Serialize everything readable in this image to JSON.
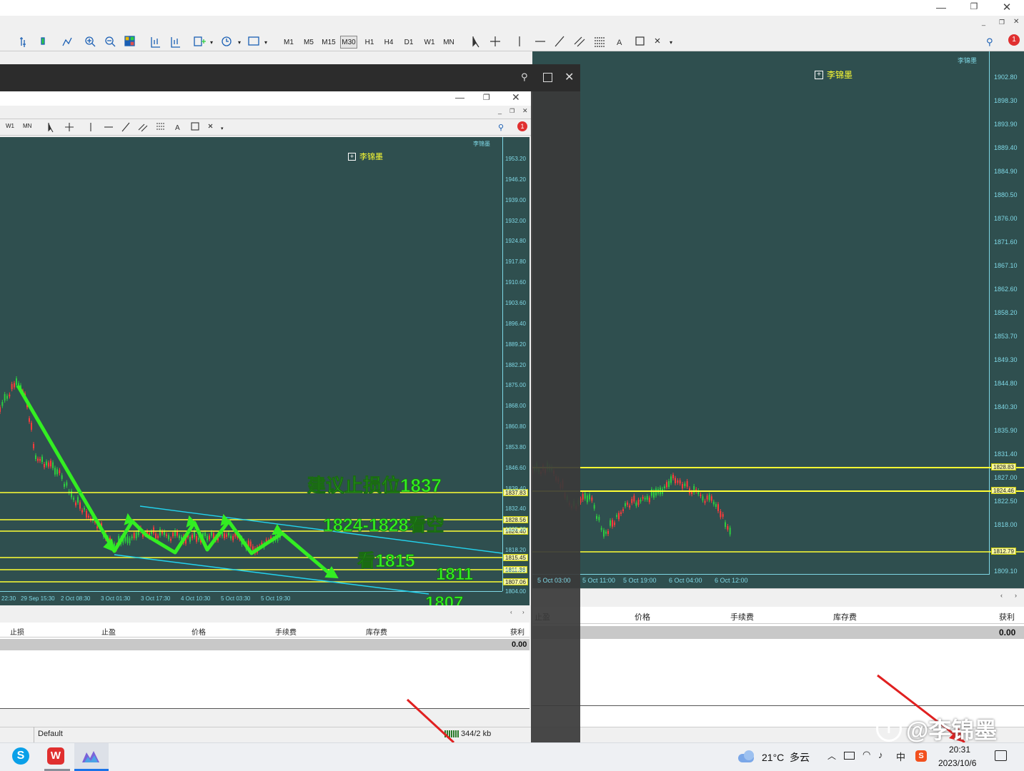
{
  "colors": {
    "chart_bg": "#2f4f4f",
    "grid_axis": "#7fd8e6",
    "level_line": "#ffff33",
    "arrow": "#33ee22",
    "channel": "#22d3ee",
    "bull": "#2ecc40",
    "bear": "#ff3b3b"
  },
  "main_window": {
    "title_controls": [
      "minimize-icon",
      "restore-icon",
      "close-icon"
    ],
    "toolbar": {
      "timeframes": [
        "M1",
        "M5",
        "M15",
        "M30",
        "H1",
        "H4",
        "D1",
        "W1",
        "MN"
      ],
      "text_tool": "A",
      "notification_count": "1"
    },
    "chart": {
      "watermark": "李锦墨",
      "price_axis": [
        "1902.80",
        "1898.30",
        "1893.90",
        "1889.40",
        "1884.90",
        "1880.50",
        "1876.00",
        "1871.60",
        "1867.10",
        "1862.60",
        "1858.20",
        "1853.70",
        "1849.30",
        "1844.80",
        "1840.30",
        "1835.90",
        "1831.40",
        "1827.00",
        "1822.50",
        "1818.00",
        "1809.10"
      ],
      "price_tags": [
        "1828.83",
        "1824.46",
        "1812.79"
      ],
      "time_axis": [
        "5 Oct 03:00",
        "5 Oct 11:00",
        "5 Oct 19:00",
        "6 Oct 04:00",
        "6 Oct 12:00"
      ]
    },
    "terminal": {
      "headers": [
        "止盈",
        "价格",
        "手续费",
        "库存费",
        "获利"
      ],
      "profit_value": "0.00"
    }
  },
  "overlay_panel": {
    "controls": [
      "pin-icon",
      "maximize-icon",
      "close-icon"
    ]
  },
  "inner_window": {
    "toolbar": {
      "timeframes": [
        "W1",
        "MN"
      ],
      "text_tool": "A",
      "notification_count": "1"
    },
    "chart": {
      "watermark": "李锦墨",
      "price_axis": [
        "1953.20",
        "1946.20",
        "1939.00",
        "1932.00",
        "1924.80",
        "1917.80",
        "1910.60",
        "1903.60",
        "1896.40",
        "1889.20",
        "1882.20",
        "1875.00",
        "1868.00",
        "1860.80",
        "1853.80",
        "1846.60",
        "1839.40",
        "1832.40",
        "1825.20",
        "1818.20",
        "1811.00",
        "1804.00"
      ],
      "price_tags": [
        "1837.83",
        "1828.56",
        "1824.40",
        "1815.45",
        "1811.36",
        "1807.06"
      ],
      "time_axis": [
        "22:30",
        "29 Sep 15:30",
        "2 Oct 08:30",
        "3 Oct 01:30",
        "3 Oct 17:30",
        "4 Oct 10:30",
        "5 Oct 03:30",
        "5 Oct 19:30"
      ],
      "annotations": {
        "stop_loss": "建议止损位1837",
        "short_zone": "1824-1828看空",
        "target1": "看1815",
        "target2": "1811",
        "target3": "1807"
      }
    },
    "terminal": {
      "headers": [
        "止损",
        "止盈",
        "价格",
        "手续费",
        "库存费",
        "获利"
      ],
      "profit_value": "0.00"
    },
    "status": {
      "profile": "Default",
      "traffic": "344/2 kb"
    }
  },
  "taskbar": {
    "weather": "21°C  多云",
    "ime": "中",
    "time": "20:31",
    "date": "2023/10/6",
    "watermark_brand": "@李锦墨"
  }
}
